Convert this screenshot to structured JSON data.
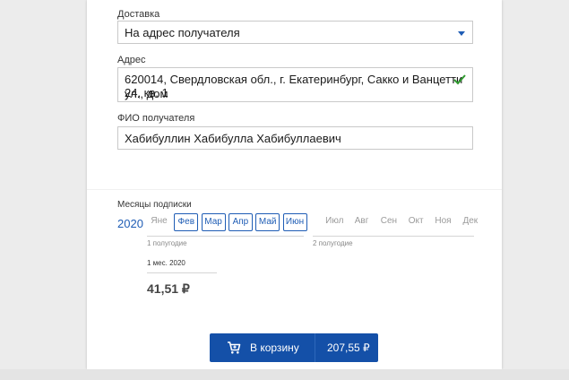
{
  "delivery": {
    "label": "Доставка",
    "value": "На адрес получателя"
  },
  "address": {
    "label": "Адрес",
    "line1": "620014, Свердловская обл., г. Екатеринбург, Сакко и Ванцетти ул., дом",
    "line2": "24, кв. 1"
  },
  "recipient": {
    "label": "ФИО получателя",
    "value": "Хабибуллин Хабибулла Хабибуллаевич"
  },
  "subscription": {
    "label": "Месяцы подписки",
    "year": "2020",
    "months": [
      "Яне",
      "Фев",
      "Мар",
      "Апр",
      "Май",
      "Июн",
      "Июл",
      "Авг",
      "Сен",
      "Окт",
      "Ноя",
      "Дек"
    ],
    "selected_months": [
      "Фев",
      "Мар",
      "Апр",
      "Май",
      "Июн"
    ],
    "half_1": "1 полугодие",
    "half_2": "2 полугодие",
    "period": "1 мес. 2020",
    "price": "41,51 ₽"
  },
  "cart": {
    "label": "В корзину",
    "total": "207,55 ₽"
  },
  "colors": {
    "accent": "#1f5db5",
    "button": "#1450a8",
    "check": "#2e9a2e"
  }
}
